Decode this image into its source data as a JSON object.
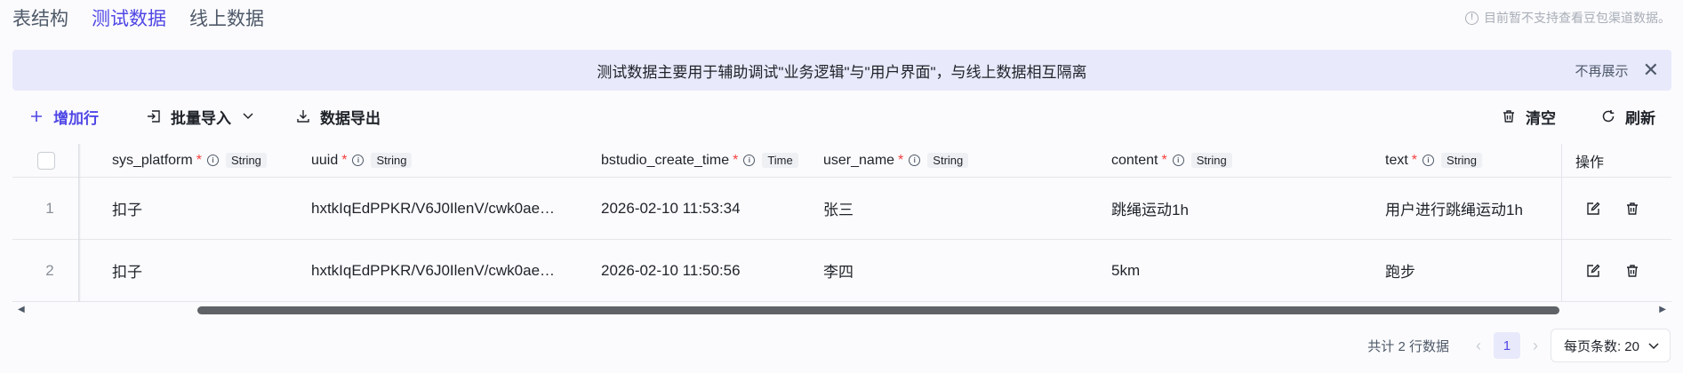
{
  "tabs": [
    {
      "label": "表结构",
      "active": false
    },
    {
      "label": "测试数据",
      "active": true
    },
    {
      "label": "线上数据",
      "active": false
    }
  ],
  "tip": "目前暂不支持查看豆包渠道数据。",
  "banner": {
    "text": "测试数据主要用于辅助调试\"业务逻辑\"与\"用户界面\"，与线上数据相互隔离",
    "dismiss_label": "不再展示",
    "close_icon": "close-icon"
  },
  "toolbar": {
    "add_label": "增加行",
    "import_label": "批量导入",
    "export_label": "数据导出",
    "clear_label": "清空",
    "refresh_label": "刷新"
  },
  "table": {
    "columns": [
      {
        "name": "sys_platform",
        "required": true,
        "type": "String"
      },
      {
        "name": "uuid",
        "required": true,
        "type": "String"
      },
      {
        "name": "bstudio_create_time",
        "required": true,
        "type": "Time"
      },
      {
        "name": "user_name",
        "required": true,
        "type": "String"
      },
      {
        "name": "content",
        "required": true,
        "type": "String"
      },
      {
        "name": "text",
        "required": true,
        "type": "String"
      }
    ],
    "ops_header": "操作",
    "rows": [
      {
        "index": "1",
        "sys_platform": "扣子",
        "uuid": "hxtkIqEdPPKR/V6J0IlenV/cwk0ae…",
        "bstudio_create_time": "2026-02-10 11:53:34",
        "user_name": "张三",
        "content": "跳绳运动1h",
        "text": "用户进行跳绳运动1h"
      },
      {
        "index": "2",
        "sys_platform": "扣子",
        "uuid": "hxtkIqEdPPKR/V6J0IlenV/cwk0ae…",
        "bstudio_create_time": "2026-02-10 11:50:56",
        "user_name": "李四",
        "content": "5km",
        "text": "跑步"
      }
    ]
  },
  "pagination": {
    "total_text": "共计 2 行数据",
    "current_page": "1",
    "page_size_text": "每页条数: 20"
  },
  "colors": {
    "accent": "#4f46e5",
    "banner_bg": "#e8e9fb",
    "required": "#f53f3f"
  }
}
